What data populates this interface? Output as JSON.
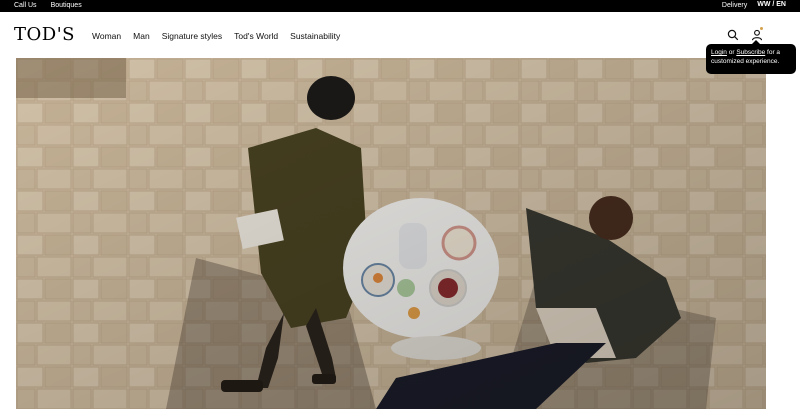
{
  "topbar": {
    "call_us": "Call Us",
    "boutiques": "Boutiques",
    "delivery": "Delivery",
    "region": "WW / EN"
  },
  "header": {
    "logo": "TOD'S",
    "nav": [
      "Woman",
      "Man",
      "Signature styles",
      "Tod's World",
      "Sustainability"
    ]
  },
  "tooltip": {
    "login": "Login",
    "or": " or ",
    "subscribe": "Subscribe",
    "rest": " for a customized experience."
  },
  "icons": {
    "search": "search-icon",
    "user": "user-icon"
  },
  "colors": {
    "topbar": "#000000",
    "accent_dot": "#d4a24c",
    "paving": "#cdb79a"
  }
}
